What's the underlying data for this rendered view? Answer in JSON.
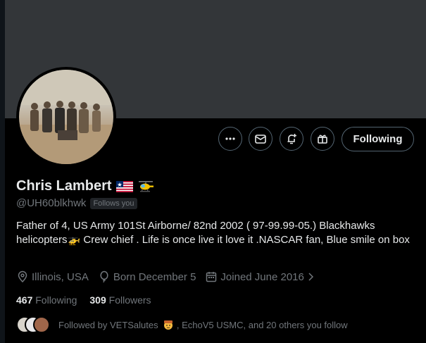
{
  "profile": {
    "name": "Chris Lambert",
    "handle": "@UH60blkhwk",
    "follows_you_badge": "Follows you",
    "bio": "Father of 4, US Army 101St Airborne/ 82nd 2002 ( 97-99.99-05.) Blackhawks helicopters🚁 Crew chief . Life is once live it love it .NASCAR fan, Blue smile on box",
    "name_emojis": [
      "liberia-flag-icon",
      "helicopter-icon"
    ]
  },
  "actions": {
    "more_icon": "more-icon",
    "message_icon": "message-icon",
    "notify_icon": "notification-bell-icon",
    "subscribe_icon": "gift-icon",
    "following_label": "Following"
  },
  "meta": {
    "location": "Illinois, USA",
    "birthday": "Born December 5",
    "joined": "Joined June 2016"
  },
  "stats": {
    "following_count": "467",
    "following_label": "Following",
    "followers_count": "309",
    "followers_label": "Followers"
  },
  "followed_by": {
    "text_prefix": "Followed by VETSalutes",
    "text_suffix": ", EchoV5 USMC, and 20 others you follow"
  },
  "colors": {
    "background": "#000000",
    "banner": "#333639",
    "secondary_text": "#71767b",
    "primary_text": "#e7e9ea",
    "border": "#536471"
  }
}
